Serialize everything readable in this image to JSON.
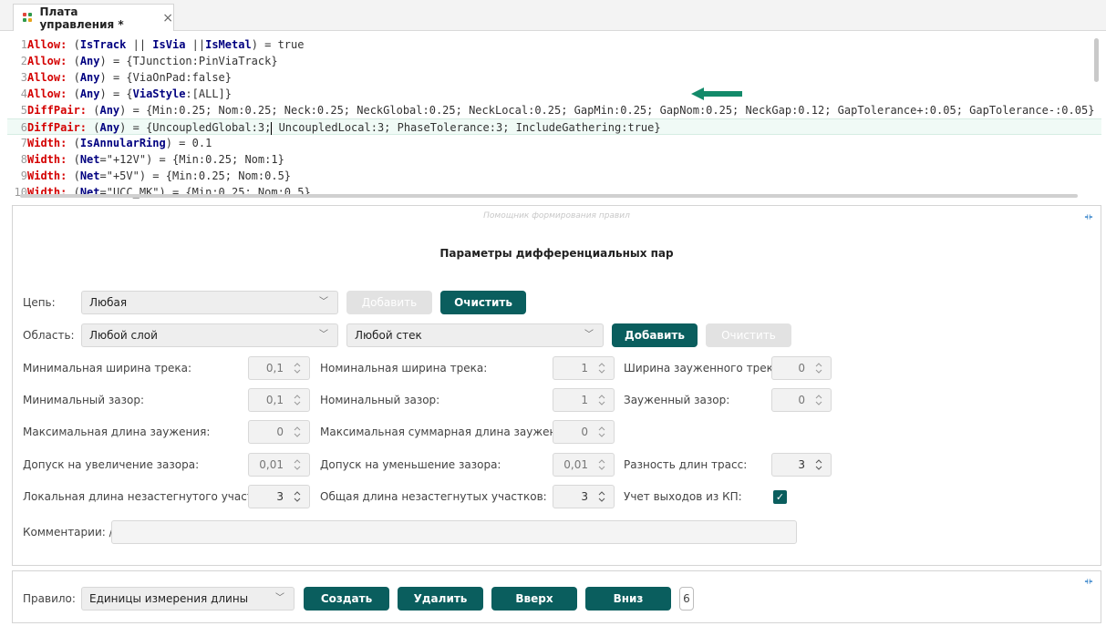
{
  "tab": {
    "title": "Плата управления *",
    "close": "×"
  },
  "editor": {
    "lines": [
      {
        "num": "1",
        "kw": "Allow:",
        "segs": [
          [
            "p",
            " ("
          ],
          [
            "i",
            "IsTrack"
          ],
          [
            "p",
            " || "
          ],
          [
            "i",
            "IsVia"
          ],
          [
            "p",
            " ||"
          ],
          [
            "i",
            "IsMetal"
          ],
          [
            "p",
            ") = true"
          ]
        ]
      },
      {
        "num": "2",
        "kw": "Allow:",
        "segs": [
          [
            "p",
            " ("
          ],
          [
            "i",
            "Any"
          ],
          [
            "p",
            ") = {TJunction:PinViaTrack}"
          ]
        ]
      },
      {
        "num": "3",
        "kw": "Allow:",
        "segs": [
          [
            "p",
            " ("
          ],
          [
            "i",
            "Any"
          ],
          [
            "p",
            ") = {ViaOnPad:false}"
          ]
        ]
      },
      {
        "num": "4",
        "kw": "Allow:",
        "segs": [
          [
            "p",
            " ("
          ],
          [
            "i",
            "Any"
          ],
          [
            "p",
            ") = {"
          ],
          [
            "i",
            "ViaStyle"
          ],
          [
            "p",
            ":[ALL]}"
          ]
        ]
      },
      {
        "num": "5",
        "kw": "DiffPair:",
        "segs": [
          [
            "p",
            " ("
          ],
          [
            "i",
            "Any"
          ],
          [
            "p",
            ") = {Min:0.25; Nom:0.25; Neck:0.25; NeckGlobal:0.25; NeckLocal:0.25; GapMin:0.25; GapNom:0.25; NeckGap:0.12; GapTolerance+:0.05; GapTolerance-:0.05}"
          ]
        ]
      },
      {
        "num": "6",
        "kw": "DiffPair:",
        "segs": [
          [
            "p",
            " ("
          ],
          [
            "i",
            "Any"
          ],
          [
            "p",
            ") = {UncoupledGlobal:3;"
          ],
          [
            "c",
            ""
          ],
          [
            "p",
            " UncoupledLocal:3; PhaseTolerance:3; IncludeGathering:true}"
          ]
        ]
      },
      {
        "num": "7",
        "kw": "Width:",
        "segs": [
          [
            "p",
            " ("
          ],
          [
            "i",
            "IsAnnularRing"
          ],
          [
            "p",
            ") = 0.1"
          ]
        ]
      },
      {
        "num": "8",
        "kw": "Width:",
        "segs": [
          [
            "p",
            " ("
          ],
          [
            "i",
            "Net"
          ],
          [
            "p",
            "=\"+12V\") = {Min:0.25; Nom:1}"
          ]
        ]
      },
      {
        "num": "9",
        "kw": "Width:",
        "segs": [
          [
            "p",
            " ("
          ],
          [
            "i",
            "Net"
          ],
          [
            "p",
            "=\"+5V\") = {Min:0.25; Nom:0.5}"
          ]
        ]
      },
      {
        "num": "10",
        "kw": "Width:",
        "segs": [
          [
            "p",
            " ("
          ],
          [
            "i",
            "Net"
          ],
          [
            "p",
            "=\"UCC_MK\") = {Min:0.25; Nom:0.5}"
          ]
        ]
      }
    ],
    "active_line": 6
  },
  "params": {
    "hint": "Помощник формирования правил",
    "title": "Параметры дифференциальных пар",
    "net_label": "Цепь:",
    "net_value": "Любая",
    "net_add": "Добавить",
    "net_clear": "Очистить",
    "area_label": "Область:",
    "area_layer": "Любой слой",
    "area_stack": "Любой стек",
    "area_add": "Добавить",
    "area_clear": "Очистить",
    "fields": {
      "min_track_width": {
        "label": "Минимальная ширина трека:",
        "value": "0,1"
      },
      "nom_track_width": {
        "label": "Номинальная ширина трека:",
        "value": "1"
      },
      "neck_track_width": {
        "label": "Ширина зауженного трека:",
        "value": "0"
      },
      "min_gap": {
        "label": "Минимальный зазор:",
        "value": "0,1"
      },
      "nom_gap": {
        "label": "Номинальный зазор:",
        "value": "1"
      },
      "neck_gap": {
        "label": "Зауженный зазор:",
        "value": "0"
      },
      "max_neck_len": {
        "label": "Максимальная длина заужения:",
        "value": "0"
      },
      "max_total_neck_len": {
        "label": "Максимальная суммарная длина заужения:",
        "value": "0"
      },
      "gap_tol_plus": {
        "label": "Допуск на увеличение зазора:",
        "value": "0,01"
      },
      "gap_tol_minus": {
        "label": "Допуск на уменьшение зазора:",
        "value": "0,01"
      },
      "length_diff": {
        "label": "Разность длин трасс:",
        "value": "3"
      },
      "local_uncoupled": {
        "label": "Локальная длина незастегнутого участка:",
        "value": "3"
      },
      "total_uncoupled": {
        "label": "Общая длина незастегнутых участков:",
        "value": "3"
      },
      "include_gathering": {
        "label": "Учет выходов из КП:",
        "checked": "✓"
      }
    },
    "comment_label": "Комментарии: //",
    "comment_value": ""
  },
  "rules": {
    "label": "Правило:",
    "value": "Единицы измерения длины",
    "create": "Создать",
    "delete": "Удалить",
    "up": "Вверх",
    "down": "Вниз",
    "count": "6"
  },
  "colors": {
    "primary": "#0a5e5e",
    "keyword": "#d40000",
    "identifier": "#000080",
    "arrow": "#138a6a"
  }
}
